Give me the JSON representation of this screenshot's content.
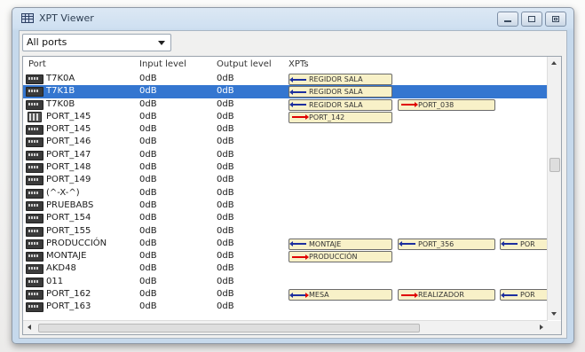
{
  "window": {
    "title": "XPT Viewer"
  },
  "filter": {
    "selected": "All ports"
  },
  "table": {
    "columns": [
      "Port",
      "Input level",
      "Output level",
      "XPTs"
    ],
    "rows": [
      {
        "name": "T7K0A",
        "input": "0dB",
        "output": "0dB",
        "icon": "device-icon",
        "xpts": [
          {
            "dir": "in",
            "label": "REGIDOR SALA"
          }
        ]
      },
      {
        "name": "T7K1B",
        "input": "0dB",
        "output": "0dB",
        "icon": "device-icon",
        "selected": true,
        "xpts": [
          {
            "dir": "in",
            "label": "REGIDOR SALA"
          }
        ]
      },
      {
        "name": "T7K0B",
        "input": "0dB",
        "output": "0dB",
        "icon": "device-icon",
        "xpts": [
          {
            "dir": "in",
            "label": "REGIDOR SALA"
          },
          {
            "dir": "out",
            "label": "PORT_038"
          }
        ]
      },
      {
        "name": "PORT_145",
        "input": "0dB",
        "output": "0dB",
        "icon": "grid-icon",
        "xpts": [
          {
            "dir": "out",
            "label": "PORT_142"
          }
        ]
      },
      {
        "name": "PORT_145",
        "input": "0dB",
        "output": "0dB",
        "icon": "device-icon",
        "xpts": []
      },
      {
        "name": "PORT_146",
        "input": "0dB",
        "output": "0dB",
        "icon": "device-icon",
        "xpts": []
      },
      {
        "name": "PORT_147",
        "input": "0dB",
        "output": "0dB",
        "icon": "device-icon",
        "xpts": []
      },
      {
        "name": "PORT_148",
        "input": "0dB",
        "output": "0dB",
        "icon": "device-icon",
        "xpts": []
      },
      {
        "name": "PORT_149",
        "input": "0dB",
        "output": "0dB",
        "icon": "device-icon",
        "xpts": []
      },
      {
        "name": "(^-X-^)",
        "input": "0dB",
        "output": "0dB",
        "icon": "device-icon",
        "xpts": []
      },
      {
        "name": "PRUEBABS",
        "input": "0dB",
        "output": "0dB",
        "icon": "device-icon",
        "xpts": []
      },
      {
        "name": "PORT_154",
        "input": "0dB",
        "output": "0dB",
        "icon": "device-icon",
        "xpts": []
      },
      {
        "name": "PORT_155",
        "input": "0dB",
        "output": "0dB",
        "icon": "device-icon",
        "xpts": []
      },
      {
        "name": "PRODUCCIÓN",
        "input": "0dB",
        "output": "0dB",
        "icon": "device-icon",
        "xpts": [
          {
            "dir": "in",
            "label": "MONTAJE"
          },
          {
            "dir": "in",
            "label": "PORT_356"
          },
          {
            "dir": "in",
            "label": "POR"
          }
        ]
      },
      {
        "name": "MONTAJE",
        "input": "0dB",
        "output": "0dB",
        "icon": "device-icon",
        "xpts": [
          {
            "dir": "out",
            "label": "PRODUCCIÓN"
          }
        ]
      },
      {
        "name": "AKD48",
        "input": "0dB",
        "output": "0dB",
        "icon": "device-icon",
        "xpts": []
      },
      {
        "name": "011",
        "input": "0dB",
        "output": "0dB",
        "icon": "device-icon",
        "xpts": []
      },
      {
        "name": "PORT_162",
        "input": "0dB",
        "output": "0dB",
        "icon": "device-icon",
        "xpts": [
          {
            "dir": "both",
            "label": "MESA"
          },
          {
            "dir": "out",
            "label": "REALIZADOR"
          },
          {
            "dir": "in",
            "label": "POR"
          }
        ]
      },
      {
        "name": "PORT_163",
        "input": "0dB",
        "output": "0dB",
        "icon": "device-icon",
        "xpts": []
      }
    ]
  }
}
